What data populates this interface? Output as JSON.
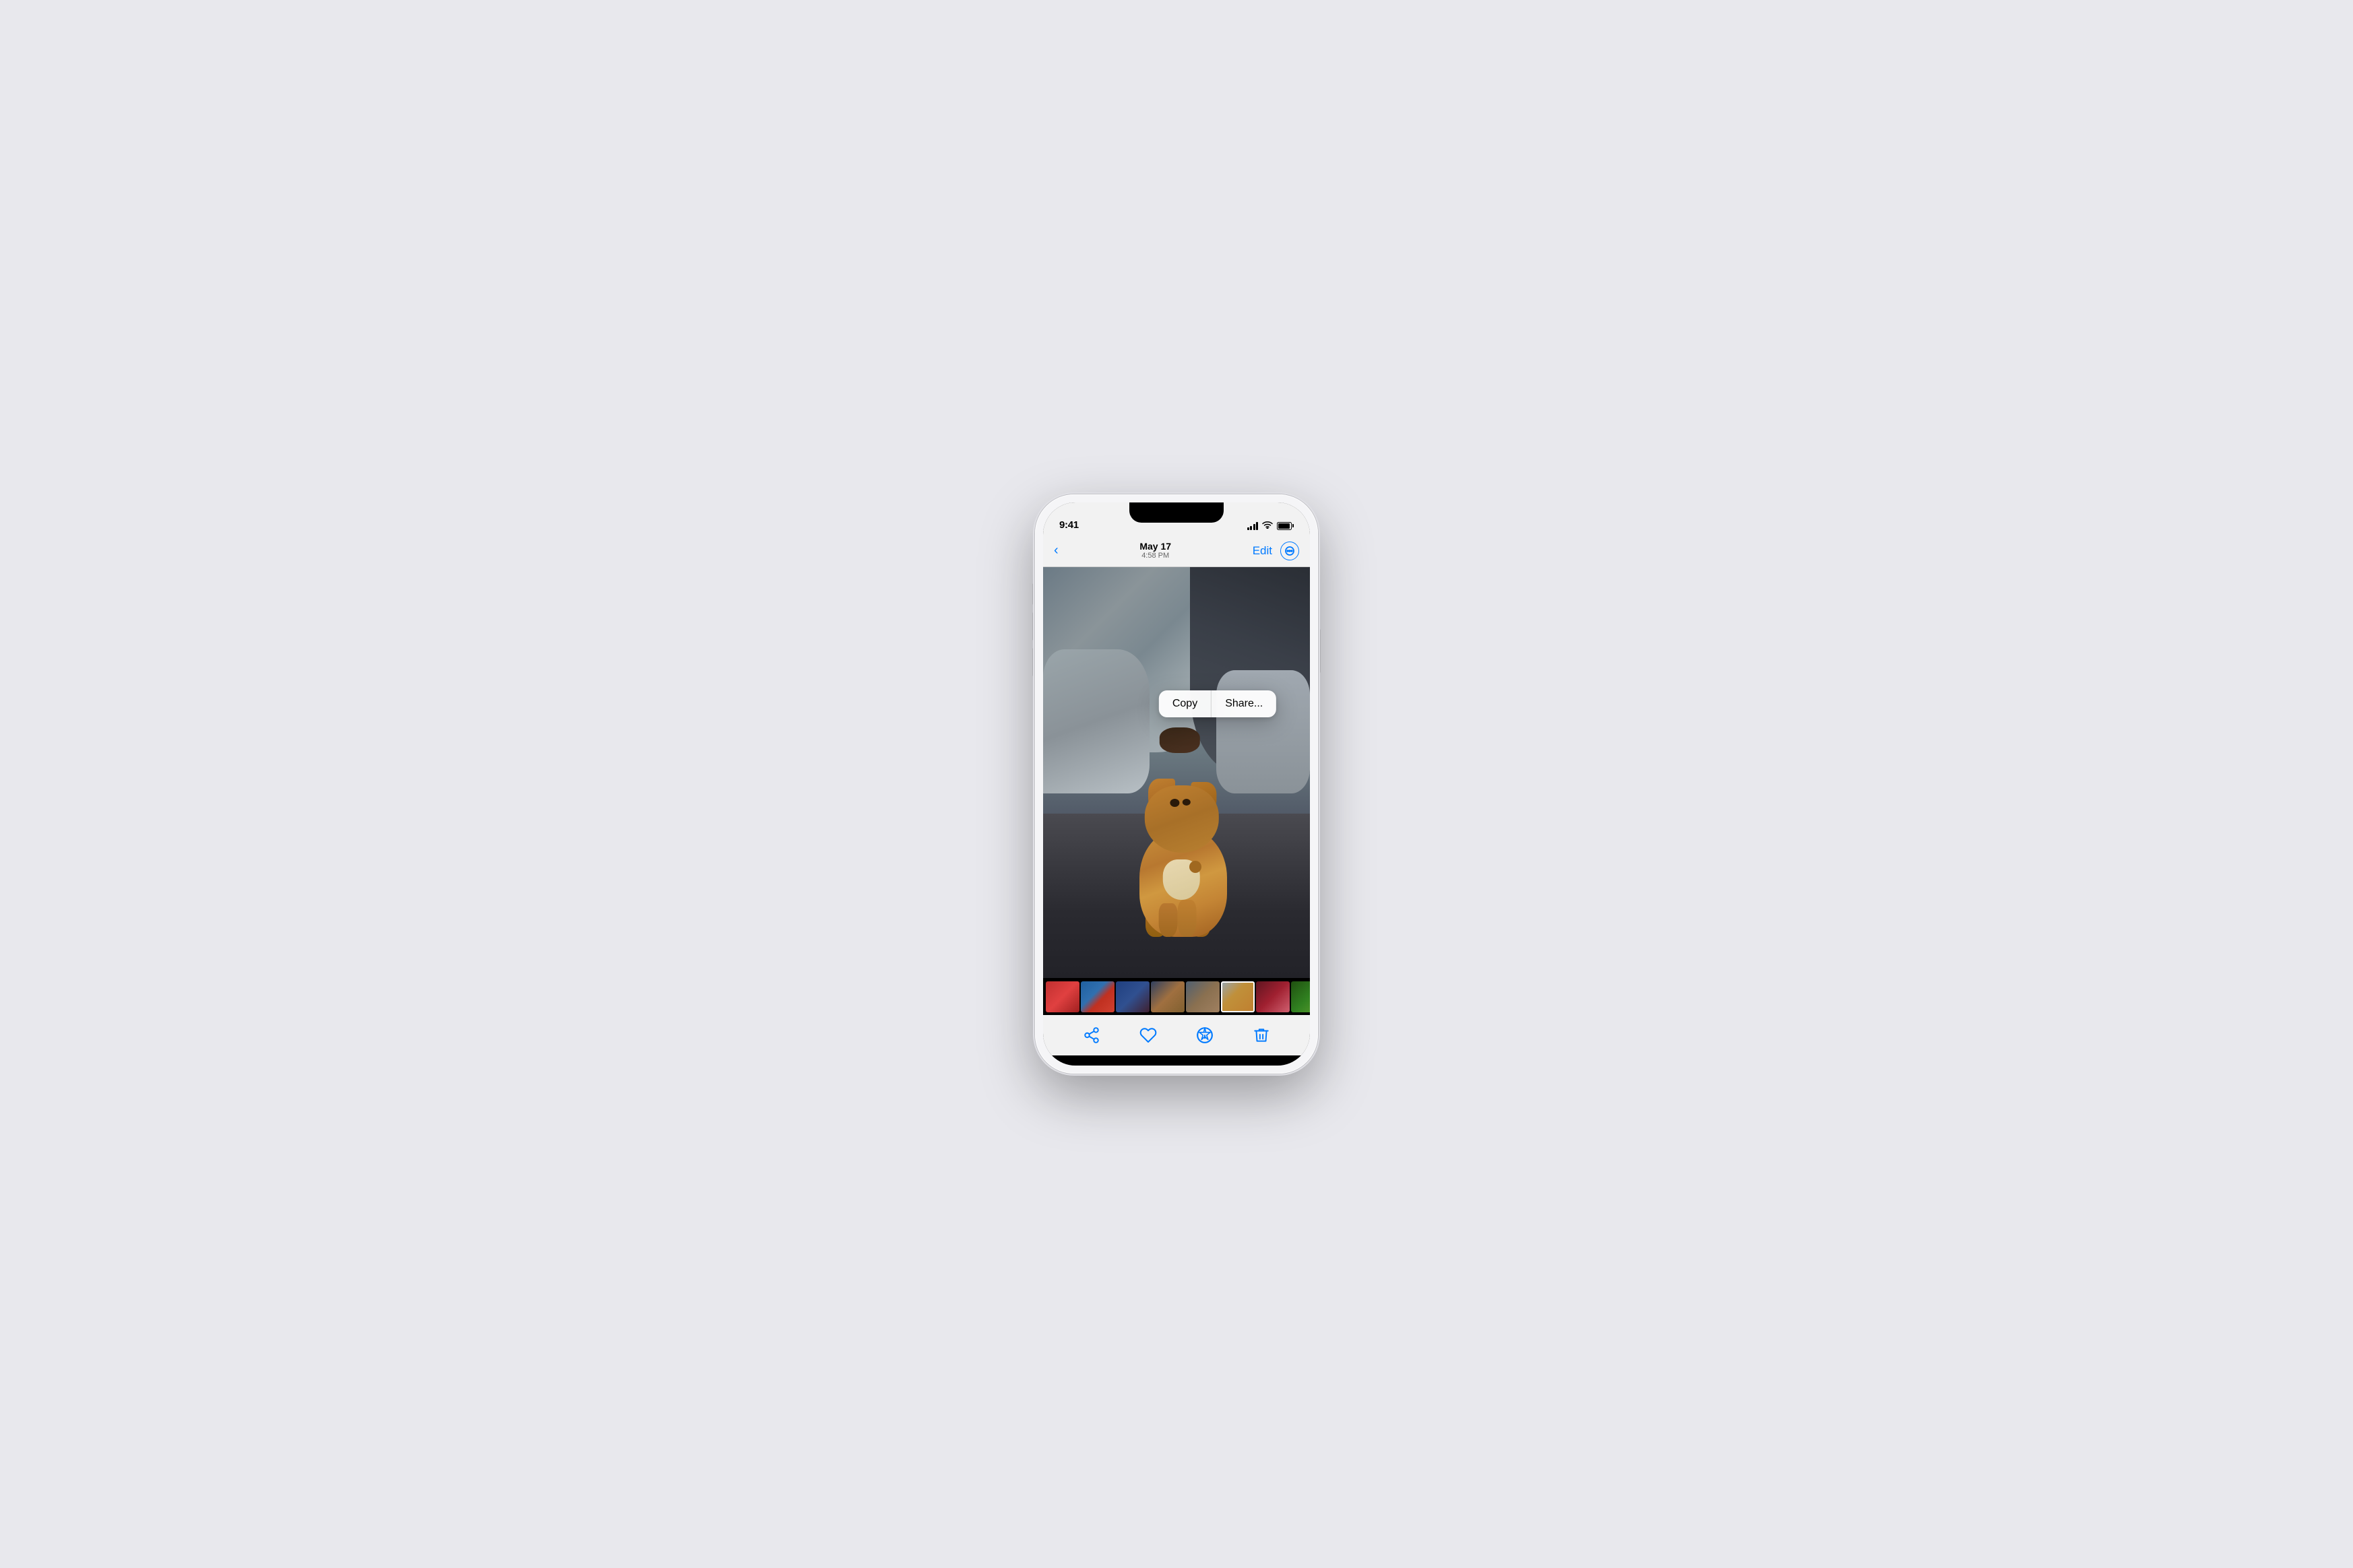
{
  "phone": {
    "status_bar": {
      "time": "9:41",
      "signal_label": "signal",
      "wifi_label": "wifi",
      "battery_label": "battery"
    },
    "nav_bar": {
      "back_label": "Back",
      "date": "May 17",
      "time": "4:58 PM",
      "edit_label": "Edit",
      "more_label": "•••"
    },
    "context_menu": {
      "copy_label": "Copy",
      "share_label": "Share..."
    },
    "toolbar": {
      "share_label": "share",
      "favorite_label": "favorite",
      "info_label": "info",
      "delete_label": "delete"
    }
  }
}
